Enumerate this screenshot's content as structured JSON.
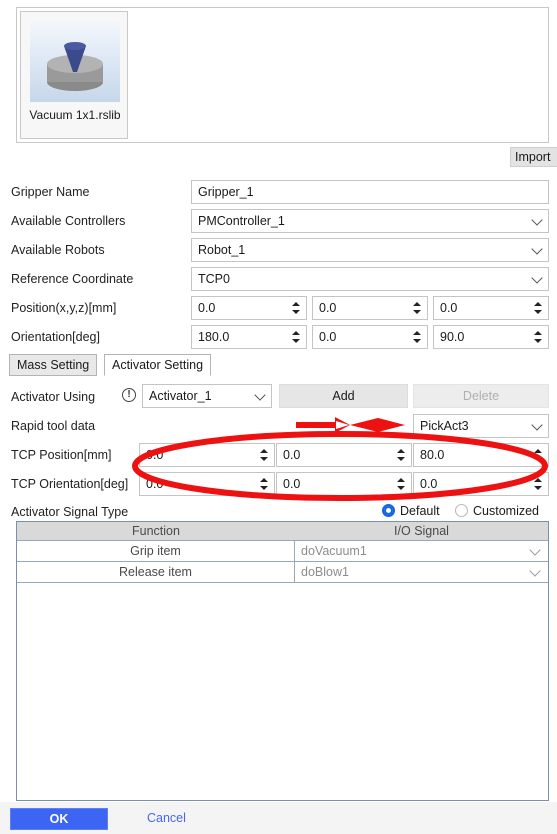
{
  "gallery": {
    "item_caption": "Vacuum 1x1.rslib",
    "import_label": "Import"
  },
  "form": {
    "rows": [
      {
        "label": "Gripper Name",
        "value": "Gripper_1"
      },
      {
        "label": "Available Controllers",
        "value": "PMController_1"
      },
      {
        "label": "Available Robots",
        "value": "Robot_1"
      },
      {
        "label": "Reference Coordinate",
        "value": "TCP0"
      }
    ],
    "position": {
      "label": "Position(x,y,z)[mm]",
      "x": "0.0",
      "y": "0.0",
      "z": "0.0"
    },
    "orientation": {
      "label": "Orientation[deg]",
      "x": "180.0",
      "y": "0.0",
      "z": "90.0"
    }
  },
  "tabs": {
    "mass": "Mass Setting",
    "activator": "Activator Setting"
  },
  "activator": {
    "using_label": "Activator Using",
    "using_value": "Activator_1",
    "add_label": "Add",
    "delete_label": "Delete",
    "rapid_label": "Rapid tool data",
    "rapid_value": "PickAct3",
    "tcp_position": {
      "label": "TCP Position[mm]",
      "x": "0.0",
      "y": "0.0",
      "z": "80.0"
    },
    "tcp_orientation": {
      "label": "TCP Orientation[deg]",
      "x": "0.0",
      "y": "0.0",
      "z": "0.0"
    },
    "signal_type_label": "Activator Signal Type",
    "signal_default": "Default",
    "signal_customized": "Customized"
  },
  "io_table": {
    "header": {
      "function": "Function",
      "signal": "I/O Signal"
    },
    "rows": [
      {
        "function": "Grip item",
        "signal": "doVacuum1"
      },
      {
        "function": "Release item",
        "signal": "doBlow1"
      }
    ]
  },
  "footer": {
    "ok": "OK",
    "cancel": "Cancel"
  },
  "colors": {
    "accent": "#3b65f2",
    "link": "#4668e8",
    "annotation": "#ee1111",
    "radio_on": "#1263e2"
  }
}
